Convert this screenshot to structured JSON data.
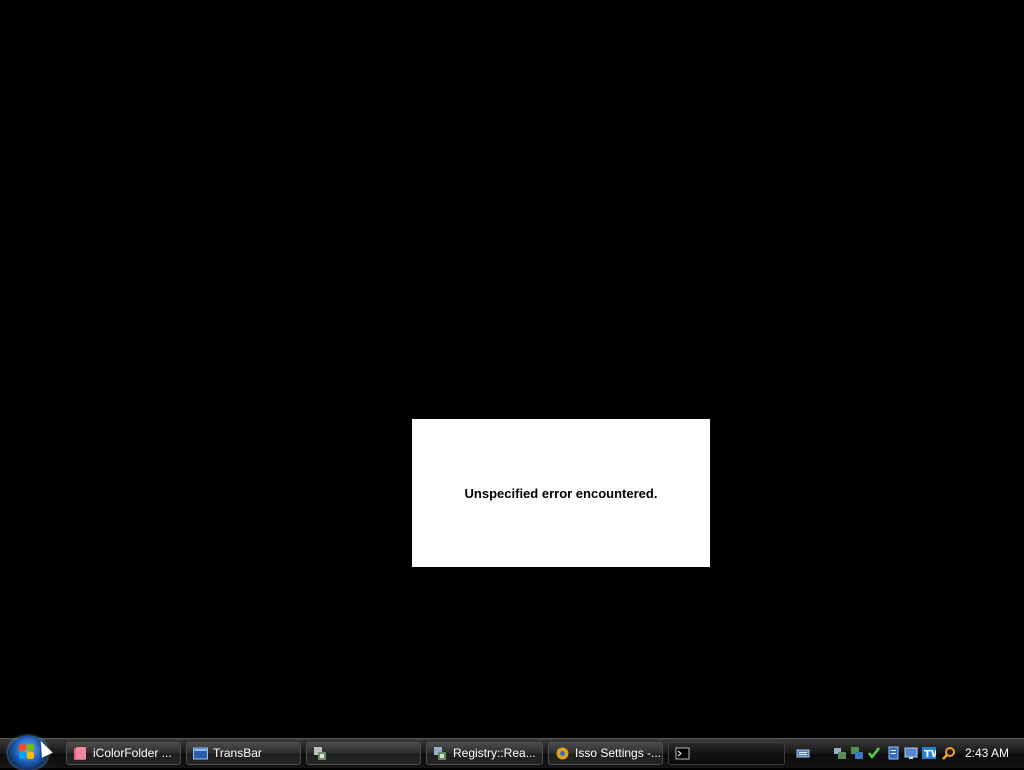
{
  "dialog": {
    "message": "Unspecified error encountered."
  },
  "taskbar": {
    "start_button": "start-orb",
    "buttons": [
      {
        "label": "iColorFolder ...",
        "icon": "folder-icon"
      },
      {
        "label": "TransBar",
        "icon": "window-icon"
      },
      {
        "label": "",
        "icon": "app-icon"
      },
      {
        "label": "Registry::Rea...",
        "icon": "registry-icon"
      },
      {
        "label": "Isso Settings -...",
        "icon": "settings-icon"
      },
      {
        "label": "",
        "icon": "console-icon"
      }
    ],
    "tray_icons": [
      "keyboard-icon",
      "network-icon",
      "monitor-icon",
      "checkmark-icon",
      "document-icon",
      "display-icon",
      "tw-icon",
      "search-icon"
    ],
    "clock": "2:43 AM"
  },
  "colors": {
    "desktop": "#000000",
    "dialog_bg": "#ffffff",
    "taskbar": "#1a1a1a"
  }
}
